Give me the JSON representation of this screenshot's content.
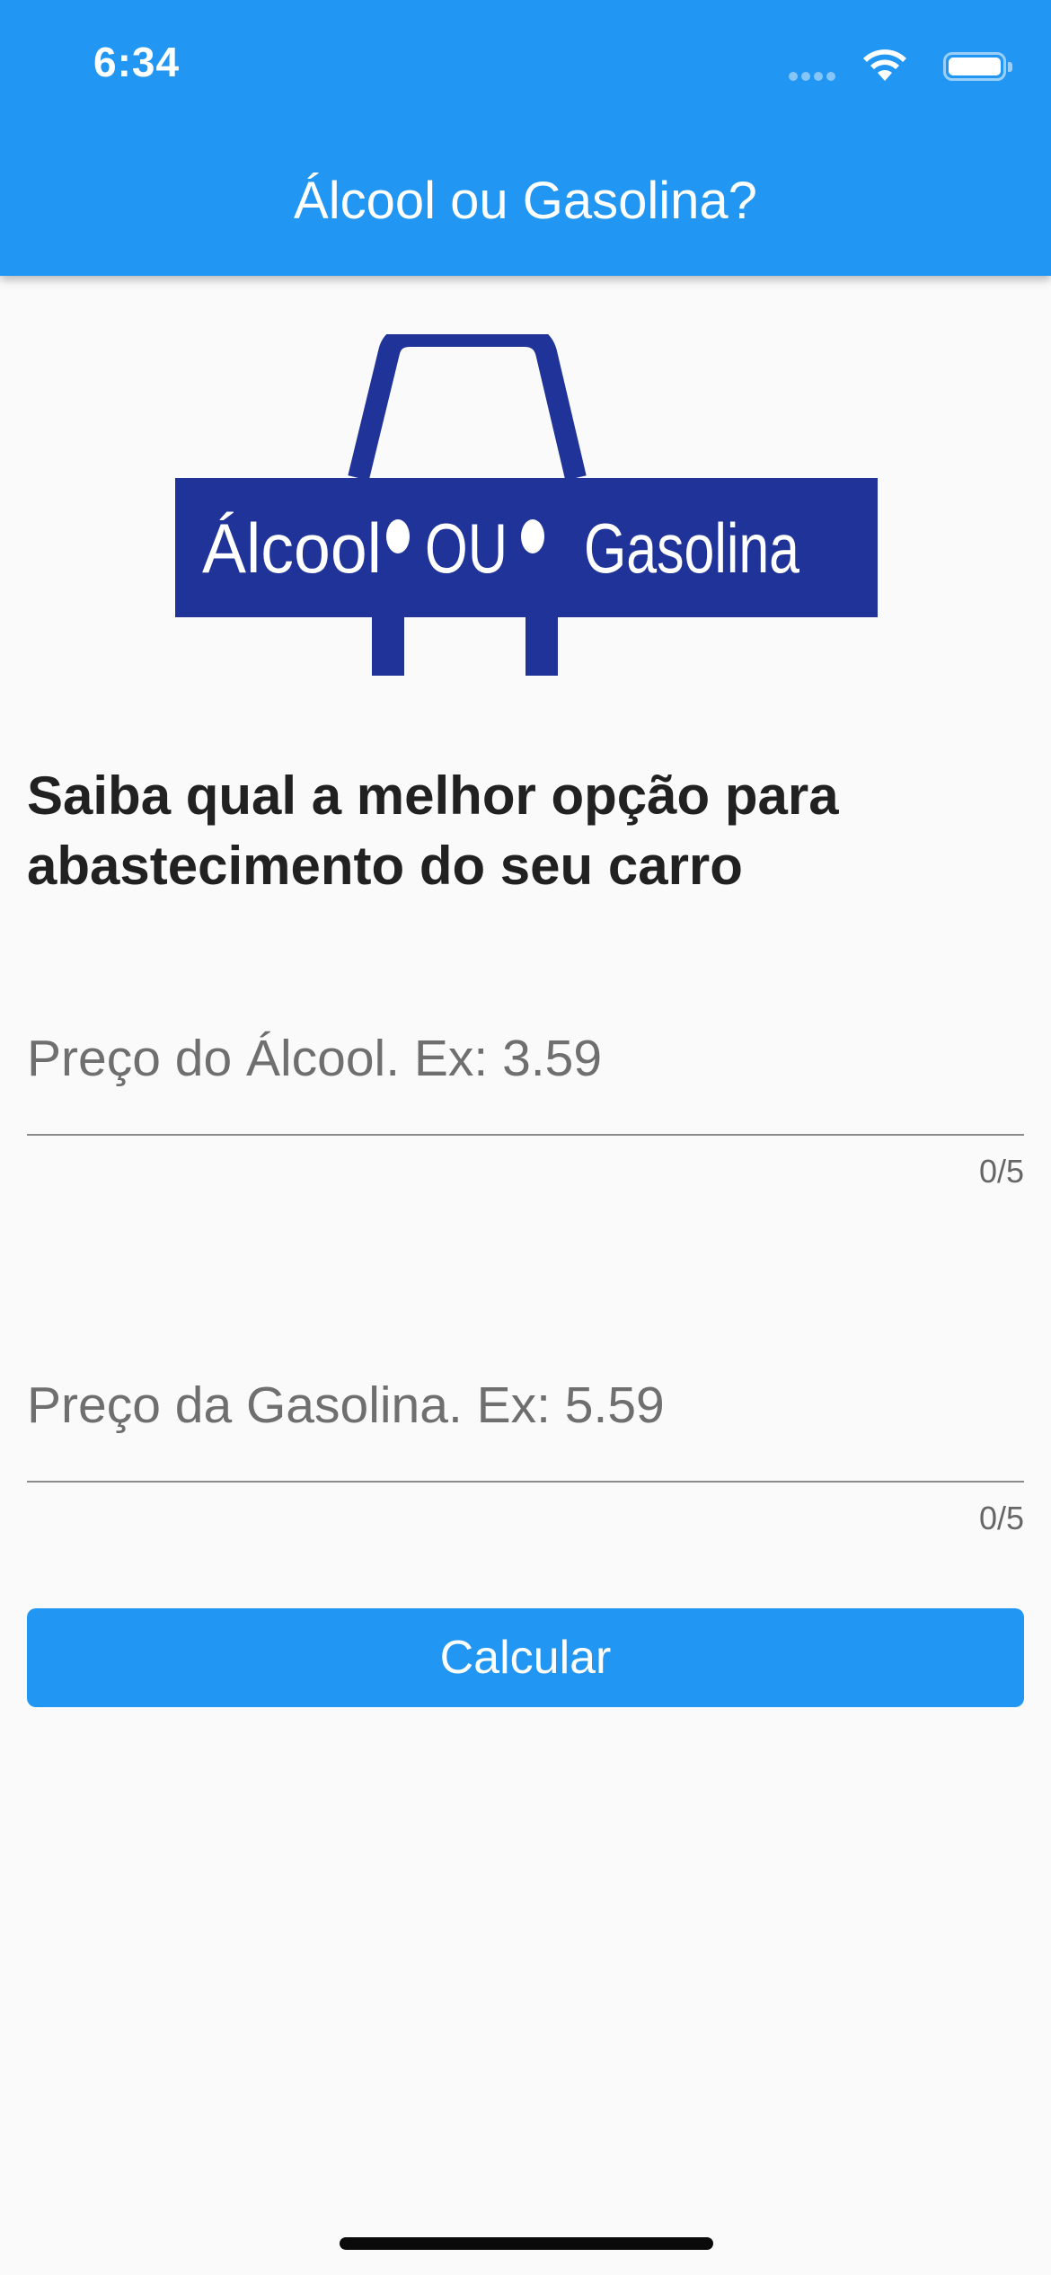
{
  "status_bar": {
    "time": "6:34",
    "icons": [
      "signal-icon",
      "wifi-icon",
      "battery-icon"
    ]
  },
  "app_bar": {
    "title": "Álcool ou Gasolina?",
    "color": "#2196f3"
  },
  "logo": {
    "text_left": "Álcool",
    "text_mid": "OU",
    "text_right": "Gasolina",
    "color": "#1f3399"
  },
  "headline": "Saiba qual a melhor opção para abastecimento do seu carro",
  "fields": [
    {
      "placeholder": "Preço do Álcool. Ex: 3.59",
      "value": "",
      "counter": "0/5"
    },
    {
      "placeholder": "Preço da Gasolina. Ex: 5.59",
      "value": "",
      "counter": "0/5"
    }
  ],
  "button": {
    "label": "Calcular"
  }
}
